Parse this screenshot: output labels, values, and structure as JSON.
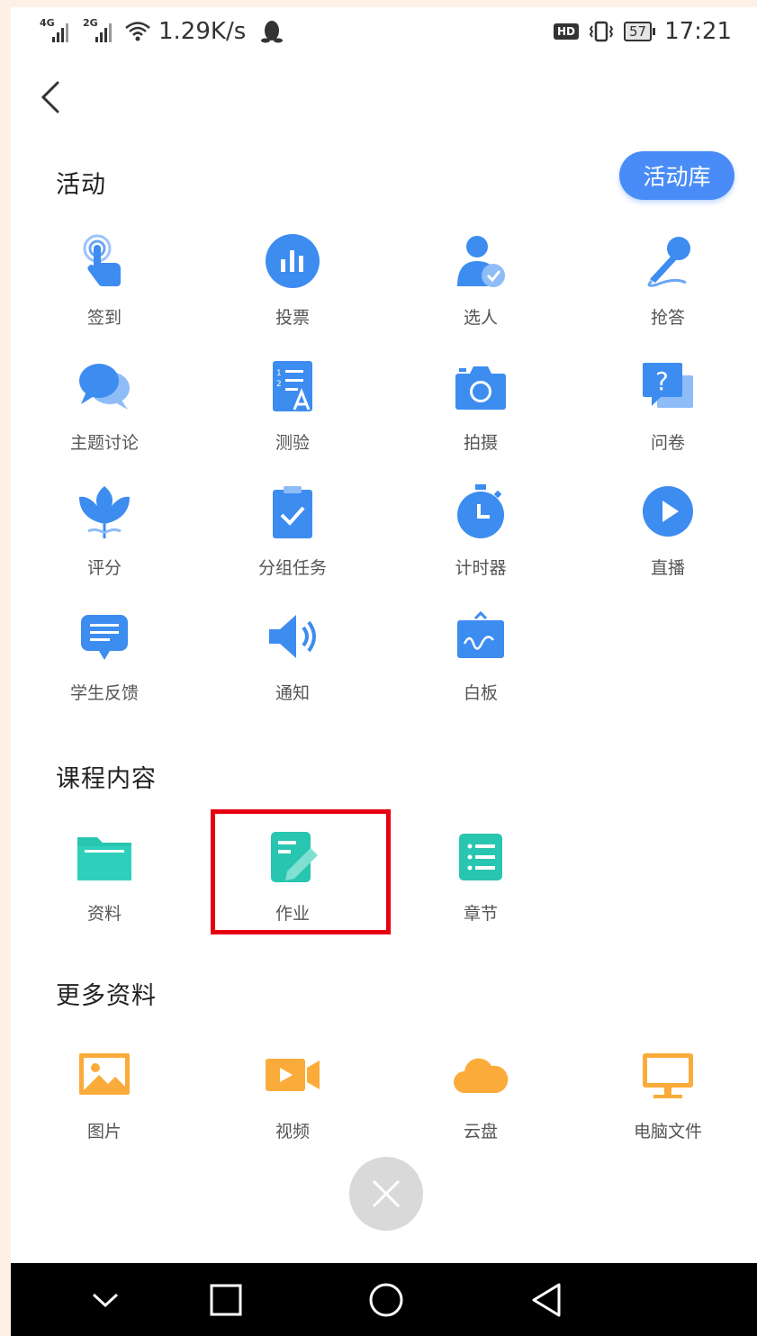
{
  "status_bar": {
    "network_1": "4G",
    "network_2": "2G",
    "speed": "1.29K/s",
    "hd": "HD",
    "battery": "57",
    "time": "17:21"
  },
  "colors": {
    "accent_blue": "#4a8cf7",
    "icon_blue": "#3d8cf0",
    "icon_teal": "#28c5b0",
    "icon_orange": "#fbab3a",
    "highlight_red": "#e60012"
  },
  "sections": {
    "activity": {
      "title": "活动",
      "library_button": "活动库",
      "items": [
        {
          "label": "签到",
          "icon": "tap-hand-icon"
        },
        {
          "label": "投票",
          "icon": "bar-chart-icon"
        },
        {
          "label": "选人",
          "icon": "person-check-icon"
        },
        {
          "label": "抢答",
          "icon": "microphone-icon"
        },
        {
          "label": "主题讨论",
          "icon": "chat-bubbles-icon"
        },
        {
          "label": "测验",
          "icon": "quiz-sheet-icon"
        },
        {
          "label": "拍摄",
          "icon": "camera-icon"
        },
        {
          "label": "问卷",
          "icon": "question-card-icon"
        },
        {
          "label": "评分",
          "icon": "flower-rating-icon"
        },
        {
          "label": "分组任务",
          "icon": "clipboard-check-icon"
        },
        {
          "label": "计时器",
          "icon": "stopwatch-icon"
        },
        {
          "label": "直播",
          "icon": "play-circle-icon"
        },
        {
          "label": "学生反馈",
          "icon": "feedback-icon"
        },
        {
          "label": "通知",
          "icon": "speaker-icon"
        },
        {
          "label": "白板",
          "icon": "whiteboard-icon"
        }
      ]
    },
    "course": {
      "title": "课程内容",
      "items": [
        {
          "label": "资料",
          "icon": "folder-icon"
        },
        {
          "label": "作业",
          "icon": "homework-pen-icon"
        },
        {
          "label": "章节",
          "icon": "list-icon"
        }
      ]
    },
    "more": {
      "title": "更多资料",
      "items": [
        {
          "label": "图片",
          "icon": "picture-icon"
        },
        {
          "label": "视频",
          "icon": "video-icon"
        },
        {
          "label": "云盘",
          "icon": "cloud-icon"
        },
        {
          "label": "电脑文件",
          "icon": "monitor-icon"
        }
      ]
    }
  }
}
